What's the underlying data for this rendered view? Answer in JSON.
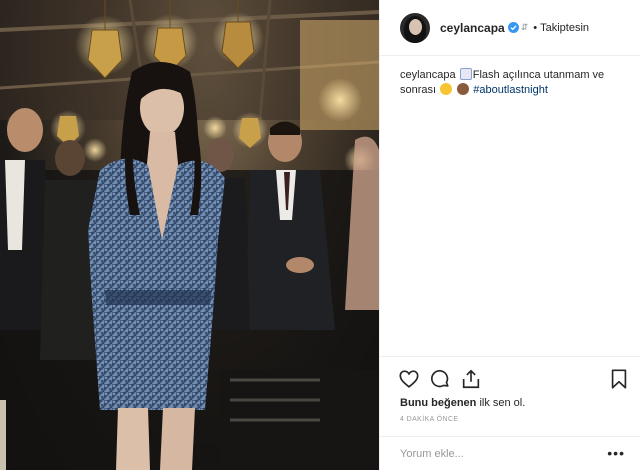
{
  "post": {
    "username": "ceylancapa",
    "follow_separator": "•",
    "follow_status": "Takiptesin",
    "caption": {
      "username": "ceylancapa",
      "text_part1": "Flash açılınca utanmam ve sonrası",
      "hashtag": "#aboutlastnight",
      "emojis": [
        "unicorn-emoji",
        "smiling-face-emoji",
        "see-no-evil-monkey-emoji"
      ]
    },
    "likes_text_bold": "Bunu beğenen",
    "likes_text_rest": " ilk sen ol.",
    "timestamp": "4 DAKİKA ÖNCE",
    "comment_placeholder": "Yorum ekle...",
    "more_label": "•••"
  },
  "icons": {
    "verified": "verified-badge-icon",
    "like": "heart-icon",
    "comment": "comment-bubble-icon",
    "share": "share-icon",
    "save": "bookmark-icon"
  },
  "colors": {
    "hashtag": "#003569",
    "verified": "#3897f0",
    "border": "#efefef"
  }
}
